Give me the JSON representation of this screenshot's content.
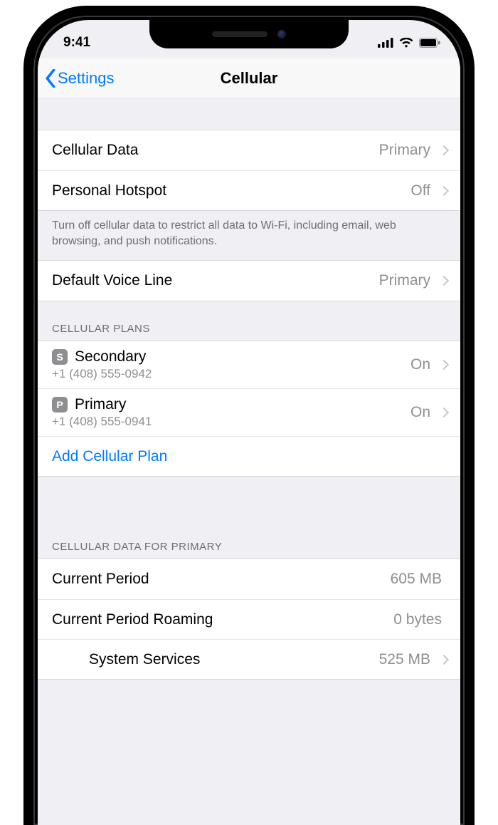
{
  "status": {
    "time": "9:41"
  },
  "nav": {
    "back_label": "Settings",
    "title": "Cellular"
  },
  "rows": {
    "cellular_data": {
      "label": "Cellular Data",
      "value": "Primary"
    },
    "personal_hotspot": {
      "label": "Personal Hotspot",
      "value": "Off"
    },
    "footer_note": "Turn off cellular data to restrict all data to Wi-Fi, including email, web browsing, and push notifications.",
    "default_voice": {
      "label": "Default Voice Line",
      "value": "Primary"
    }
  },
  "plans": {
    "header": "CELLULAR PLANS",
    "items": [
      {
        "badge": "S",
        "name": "Secondary",
        "number": "+1 (408) 555-0942",
        "status": "On"
      },
      {
        "badge": "P",
        "name": "Primary",
        "number": "+1 (408) 555-0941",
        "status": "On"
      }
    ],
    "add_label": "Add Cellular Plan"
  },
  "usage": {
    "header": "CELLULAR DATA FOR PRIMARY",
    "current_period": {
      "label": "Current Period",
      "value": "605 MB"
    },
    "roaming": {
      "label": "Current Period Roaming",
      "value": "0 bytes"
    },
    "system_services": {
      "label": "System Services",
      "value": "525 MB"
    }
  }
}
